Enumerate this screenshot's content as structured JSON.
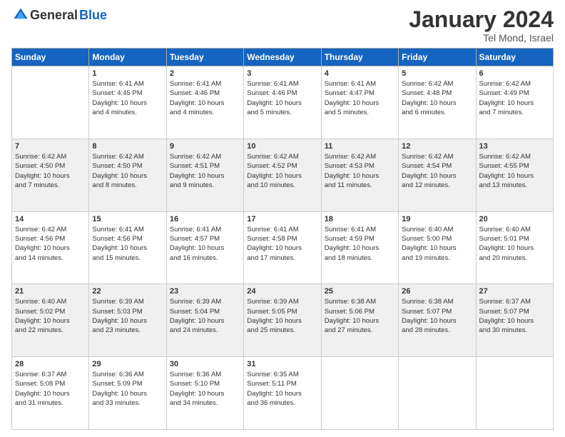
{
  "header": {
    "logo_general": "General",
    "logo_blue": "Blue",
    "month_title": "January 2024",
    "location": "Tel Mond, Israel"
  },
  "days_of_week": [
    "Sunday",
    "Monday",
    "Tuesday",
    "Wednesday",
    "Thursday",
    "Friday",
    "Saturday"
  ],
  "weeks": [
    [
      {
        "day": "",
        "info": ""
      },
      {
        "day": "1",
        "info": "Sunrise: 6:41 AM\nSunset: 4:45 PM\nDaylight: 10 hours\nand 4 minutes."
      },
      {
        "day": "2",
        "info": "Sunrise: 6:41 AM\nSunset: 4:46 PM\nDaylight: 10 hours\nand 4 minutes."
      },
      {
        "day": "3",
        "info": "Sunrise: 6:41 AM\nSunset: 4:46 PM\nDaylight: 10 hours\nand 5 minutes."
      },
      {
        "day": "4",
        "info": "Sunrise: 6:41 AM\nSunset: 4:47 PM\nDaylight: 10 hours\nand 5 minutes."
      },
      {
        "day": "5",
        "info": "Sunrise: 6:42 AM\nSunset: 4:48 PM\nDaylight: 10 hours\nand 6 minutes."
      },
      {
        "day": "6",
        "info": "Sunrise: 6:42 AM\nSunset: 4:49 PM\nDaylight: 10 hours\nand 7 minutes."
      }
    ],
    [
      {
        "day": "7",
        "info": "Sunrise: 6:42 AM\nSunset: 4:50 PM\nDaylight: 10 hours\nand 7 minutes."
      },
      {
        "day": "8",
        "info": "Sunrise: 6:42 AM\nSunset: 4:50 PM\nDaylight: 10 hours\nand 8 minutes."
      },
      {
        "day": "9",
        "info": "Sunrise: 6:42 AM\nSunset: 4:51 PM\nDaylight: 10 hours\nand 9 minutes."
      },
      {
        "day": "10",
        "info": "Sunrise: 6:42 AM\nSunset: 4:52 PM\nDaylight: 10 hours\nand 10 minutes."
      },
      {
        "day": "11",
        "info": "Sunrise: 6:42 AM\nSunset: 4:53 PM\nDaylight: 10 hours\nand 11 minutes."
      },
      {
        "day": "12",
        "info": "Sunrise: 6:42 AM\nSunset: 4:54 PM\nDaylight: 10 hours\nand 12 minutes."
      },
      {
        "day": "13",
        "info": "Sunrise: 6:42 AM\nSunset: 4:55 PM\nDaylight: 10 hours\nand 13 minutes."
      }
    ],
    [
      {
        "day": "14",
        "info": "Sunrise: 6:42 AM\nSunset: 4:56 PM\nDaylight: 10 hours\nand 14 minutes."
      },
      {
        "day": "15",
        "info": "Sunrise: 6:41 AM\nSunset: 4:56 PM\nDaylight: 10 hours\nand 15 minutes."
      },
      {
        "day": "16",
        "info": "Sunrise: 6:41 AM\nSunset: 4:57 PM\nDaylight: 10 hours\nand 16 minutes."
      },
      {
        "day": "17",
        "info": "Sunrise: 6:41 AM\nSunset: 4:58 PM\nDaylight: 10 hours\nand 17 minutes."
      },
      {
        "day": "18",
        "info": "Sunrise: 6:41 AM\nSunset: 4:59 PM\nDaylight: 10 hours\nand 18 minutes."
      },
      {
        "day": "19",
        "info": "Sunrise: 6:40 AM\nSunset: 5:00 PM\nDaylight: 10 hours\nand 19 minutes."
      },
      {
        "day": "20",
        "info": "Sunrise: 6:40 AM\nSunset: 5:01 PM\nDaylight: 10 hours\nand 20 minutes."
      }
    ],
    [
      {
        "day": "21",
        "info": "Sunrise: 6:40 AM\nSunset: 5:02 PM\nDaylight: 10 hours\nand 22 minutes."
      },
      {
        "day": "22",
        "info": "Sunrise: 6:39 AM\nSunset: 5:03 PM\nDaylight: 10 hours\nand 23 minutes."
      },
      {
        "day": "23",
        "info": "Sunrise: 6:39 AM\nSunset: 5:04 PM\nDaylight: 10 hours\nand 24 minutes."
      },
      {
        "day": "24",
        "info": "Sunrise: 6:39 AM\nSunset: 5:05 PM\nDaylight: 10 hours\nand 25 minutes."
      },
      {
        "day": "25",
        "info": "Sunrise: 6:38 AM\nSunset: 5:06 PM\nDaylight: 10 hours\nand 27 minutes."
      },
      {
        "day": "26",
        "info": "Sunrise: 6:38 AM\nSunset: 5:07 PM\nDaylight: 10 hours\nand 28 minutes."
      },
      {
        "day": "27",
        "info": "Sunrise: 6:37 AM\nSunset: 5:07 PM\nDaylight: 10 hours\nand 30 minutes."
      }
    ],
    [
      {
        "day": "28",
        "info": "Sunrise: 6:37 AM\nSunset: 5:08 PM\nDaylight: 10 hours\nand 31 minutes."
      },
      {
        "day": "29",
        "info": "Sunrise: 6:36 AM\nSunset: 5:09 PM\nDaylight: 10 hours\nand 33 minutes."
      },
      {
        "day": "30",
        "info": "Sunrise: 6:36 AM\nSunset: 5:10 PM\nDaylight: 10 hours\nand 34 minutes."
      },
      {
        "day": "31",
        "info": "Sunrise: 6:35 AM\nSunset: 5:11 PM\nDaylight: 10 hours\nand 36 minutes."
      },
      {
        "day": "",
        "info": ""
      },
      {
        "day": "",
        "info": ""
      },
      {
        "day": "",
        "info": ""
      }
    ]
  ]
}
